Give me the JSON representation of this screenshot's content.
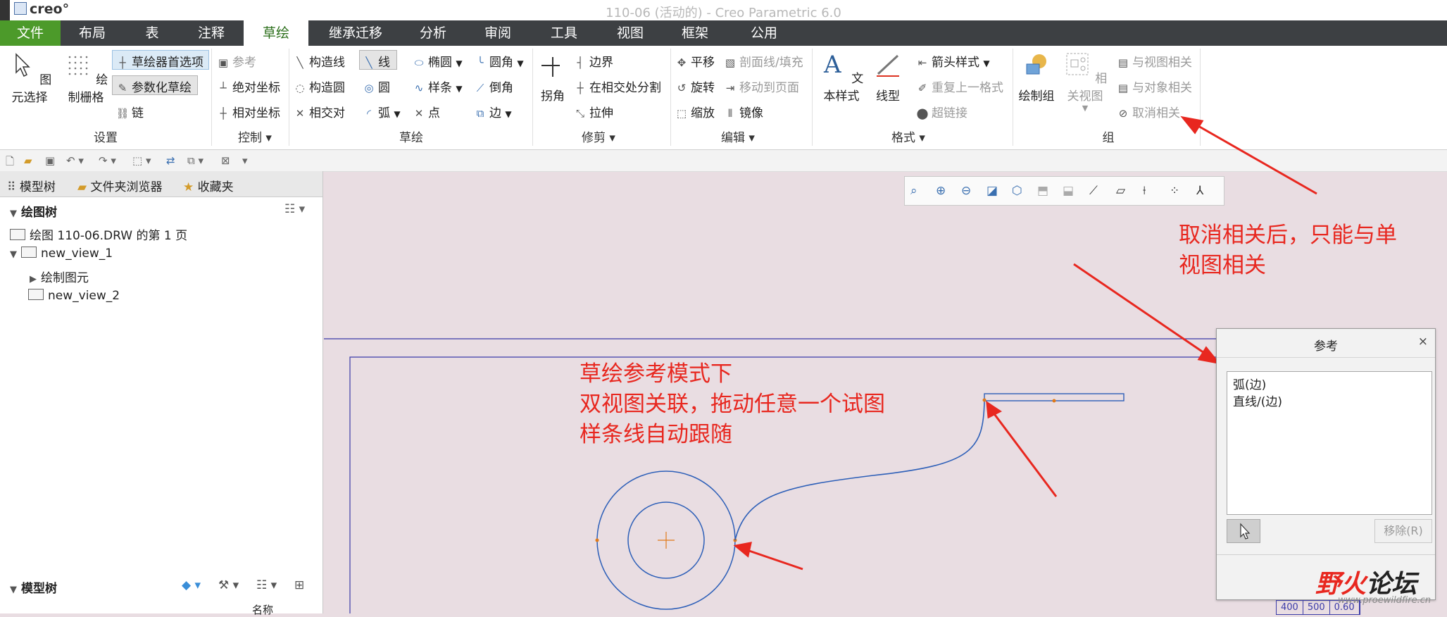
{
  "window": {
    "title": "110-06 (活动的) - Creo Parametric 6.0",
    "logo": "creo°"
  },
  "menu": {
    "file": "文件",
    "items": [
      "布局",
      "表",
      "注释",
      "草绘",
      "继承迁移",
      "分析",
      "审阅",
      "工具",
      "视图",
      "框架",
      "公用"
    ]
  },
  "ribbon": {
    "setup": {
      "select": "图元选择",
      "grid": "绘制栅格",
      "prefs": "草绘器首选项",
      "param": "参数化草绘",
      "chain": "链",
      "label": "设置"
    },
    "control": {
      "ref": "参考",
      "abs": "绝对坐标",
      "rel": "相对坐标",
      "label": "控制"
    },
    "sketch": {
      "conline": "构造线",
      "concircle": "构造圆",
      "relative": "相交对",
      "line": "线",
      "circle": "圆",
      "arc": "弧",
      "ellipse": "椭圆",
      "spline": "样条",
      "point": "点",
      "fillet": "圆角",
      "chamfer": "倒角",
      "edge": "边",
      "label": "草绘"
    },
    "trim": {
      "corner": "拐角",
      "bound": "边界",
      "divide": "在相交处分割",
      "stretch": "拉伸",
      "label": "修剪"
    },
    "edit": {
      "translate": "平移",
      "rotate": "旋转",
      "scale": "缩放",
      "hatch": "剖面线/填充",
      "move": "移动到页面",
      "mirror": "镜像",
      "label": "编辑"
    },
    "format": {
      "text": "文本样式",
      "linestyle": "线型",
      "arrow": "箭头样式",
      "repeat": "重复上一格式",
      "hyper": "超链接",
      "label": "格式"
    },
    "group": {
      "draw": "绘制组",
      "related": "相关视图",
      "toview": "与视图相关",
      "toobj": "与对象相关",
      "unrelate": "取消相关",
      "label": "组"
    }
  },
  "leftpanel": {
    "tabs": [
      "模型树",
      "文件夹浏览器",
      "收藏夹"
    ],
    "drawtree_label": "绘图树",
    "items": [
      "绘图 110-06.DRW 的第 1 页",
      "new_view_1",
      "绘制图元",
      "new_view_2"
    ],
    "modeltree_label": "模型树",
    "column": "名称"
  },
  "annotations": {
    "top_right": [
      "取消相关后，只能与单",
      "视图相关"
    ],
    "center": [
      "草绘参考模式下",
      "双视图关联，拖动任意一个试图",
      "样条线自动跟随"
    ]
  },
  "dialog": {
    "title": "参考",
    "close": "×",
    "items": [
      "弧(边)",
      "直线/(边)"
    ],
    "remove": "移除(R)"
  },
  "watermark": {
    "brand_a": "野火",
    "brand_b": "论坛",
    "url": "www.proewildfire.cn"
  },
  "table_fragment": [
    "400",
    "500",
    "0.60"
  ]
}
